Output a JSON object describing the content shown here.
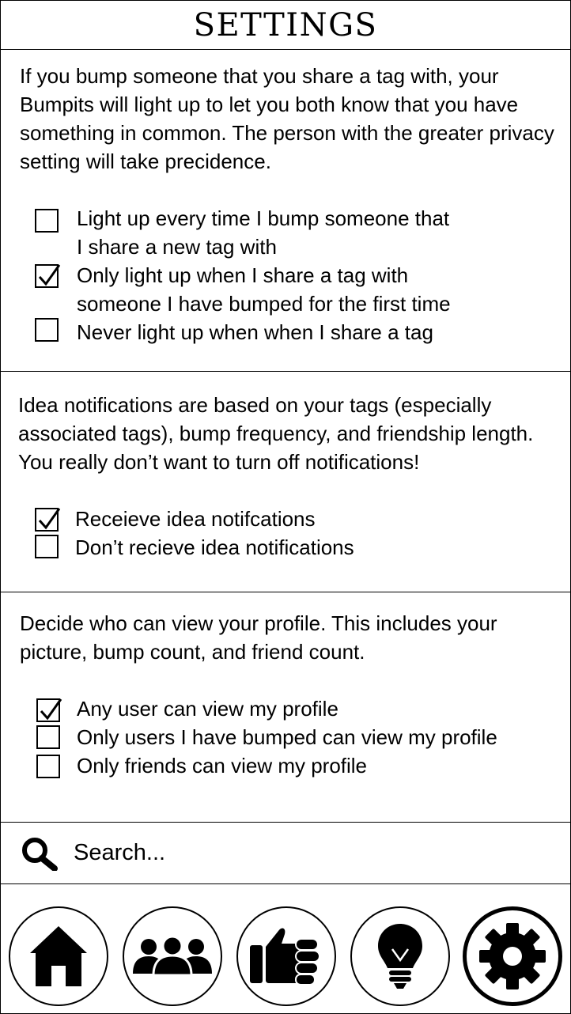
{
  "header": {
    "title": "SETTINGS"
  },
  "bump_section": {
    "description": "If you bump someone that you share a tag with, your Bumpits will light up to let you both know that you have something in common. The person with the greater privacy setting will take precidence.",
    "options": [
      {
        "line1": "Light up every time I bump someone that",
        "line2": "I share a new tag with",
        "checked": false
      },
      {
        "line1": "Only light up when I share a tag with",
        "line2": "someone I have bumped for the first time",
        "checked": true
      },
      {
        "line1": "Never light up when when I share a tag",
        "line2": "",
        "checked": false
      }
    ]
  },
  "idea_section": {
    "description": "Idea notifications are based on your tags (especially associated tags), bump frequency, and friendship length. You really don’t want to turn off notifications!",
    "options": [
      {
        "line1": "Receieve idea notifcations",
        "checked": true
      },
      {
        "line1": "Don’t recieve idea notifications",
        "checked": false
      }
    ]
  },
  "profile_section": {
    "description": "Decide who can view your profile. This includes your picture, bump count, and friend count.",
    "options": [
      {
        "line1": "Any user can view my profile",
        "checked": true
      },
      {
        "line1": "Only users I have bumped can view my profile",
        "checked": false
      },
      {
        "line1": "Only friends can view my profile",
        "checked": false
      }
    ]
  },
  "search": {
    "placeholder": "Search...",
    "icon": "search-icon"
  },
  "nav": {
    "items": [
      {
        "icon": "home-icon",
        "active": false
      },
      {
        "icon": "friends-icon",
        "active": false
      },
      {
        "icon": "fist-bump-icon",
        "active": false
      },
      {
        "icon": "lightbulb-icon",
        "active": false
      },
      {
        "icon": "gear-icon",
        "active": true
      }
    ]
  }
}
